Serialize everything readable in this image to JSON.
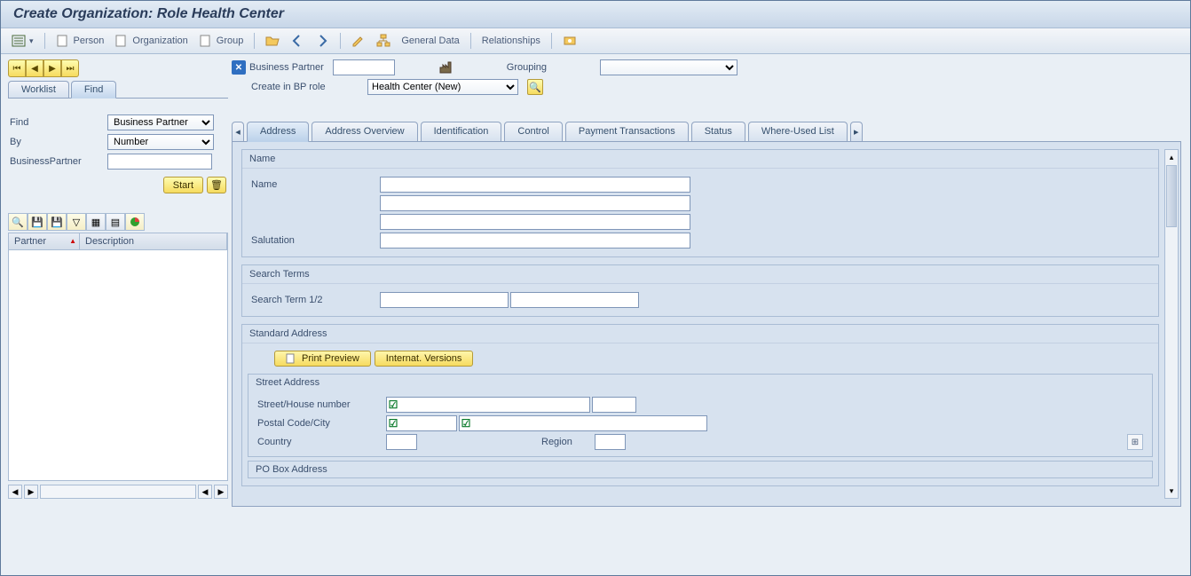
{
  "title": "Create Organization: Role Health Center",
  "toolbar": {
    "menu_icon": "menu",
    "person": "Person",
    "organization": "Organization",
    "group": "Group",
    "general_data": "General Data",
    "relationships": "Relationships"
  },
  "bp_header": {
    "bp_label": "Business Partner",
    "bp_value": "",
    "grouping_label": "Grouping",
    "grouping_value": "",
    "role_label": "Create in BP role",
    "role_value": "Health Center (New)"
  },
  "left": {
    "tabs": {
      "worklist": "Worklist",
      "find": "Find"
    },
    "find_label": "Find",
    "find_value": "Business Partner",
    "by_label": "By",
    "by_value": "Number",
    "bp_label": "BusinessPartner",
    "bp_value": "",
    "start_btn": "Start",
    "grid": {
      "col1": "Partner",
      "col2": "Description"
    }
  },
  "main_tabs": {
    "address": "Address",
    "overview": "Address Overview",
    "identification": "Identification",
    "control": "Control",
    "payment": "Payment Transactions",
    "status": "Status",
    "where": "Where-Used List"
  },
  "sections": {
    "name": {
      "title": "Name",
      "name_label": "Name",
      "name_value1": "",
      "name_value2": "",
      "name_value3": "",
      "salutation_label": "Salutation",
      "salutation_value": ""
    },
    "search": {
      "title": "Search Terms",
      "term_label": "Search Term 1/2",
      "term_value1": "",
      "term_value2": ""
    },
    "address": {
      "title": "Standard Address",
      "print_btn": "Print Preview",
      "intl_btn": "Internat. Versions",
      "street_title": "Street Address",
      "street_label": "Street/House number",
      "postal_label": "Postal Code/City",
      "country_label": "Country",
      "region_label": "Region",
      "pobox_title": "PO Box Address"
    }
  }
}
